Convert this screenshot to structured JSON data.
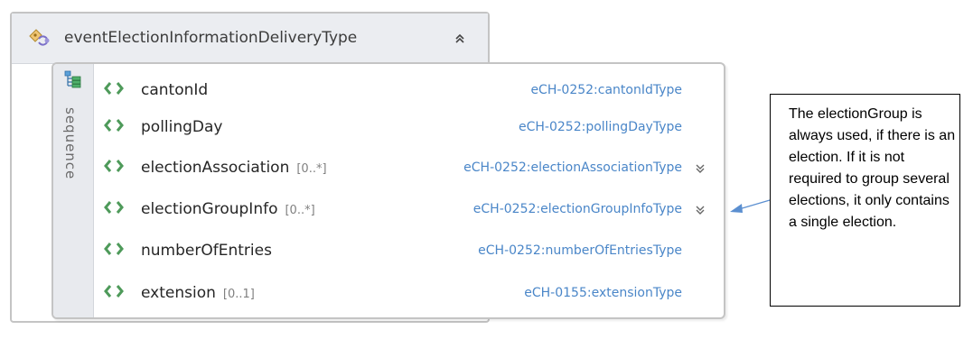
{
  "complex_type": {
    "name": "eventElectionInformationDeliveryType",
    "icon": "complex-type-icon",
    "collapse_icon": "collapse-chevrons-icon"
  },
  "sequence": {
    "label": "sequence",
    "icon": "sequence-icon",
    "elements": [
      {
        "name": "cantonId",
        "cardinality": "",
        "type": "eCH-0252:cantonIdType",
        "expandable": false
      },
      {
        "name": "pollingDay",
        "cardinality": "",
        "type": "eCH-0252:pollingDayType",
        "expandable": false
      },
      {
        "name": "electionAssociation",
        "cardinality": "[0..*]",
        "type": "eCH-0252:electionAssociationType",
        "expandable": true
      },
      {
        "name": "electionGroupInfo",
        "cardinality": "[0..*]",
        "type": "eCH-0252:electionGroupInfoType",
        "expandable": true
      },
      {
        "name": "numberOfEntries",
        "cardinality": "",
        "type": "eCH-0252:numberOfEntriesType",
        "expandable": false
      },
      {
        "name": "extension",
        "cardinality": "[0..1]",
        "type": "eCH-0155:extensionType",
        "expandable": false
      }
    ]
  },
  "annotation": {
    "text": "The electionGroup is always used, if there is an election. If it is not required to group several elections, it only contains a single election."
  },
  "colors": {
    "type_text": "#4a86c8",
    "element_icon": "#4e9a5a",
    "header_bg": "#ebedf1",
    "connector": "#5b8fd0"
  }
}
